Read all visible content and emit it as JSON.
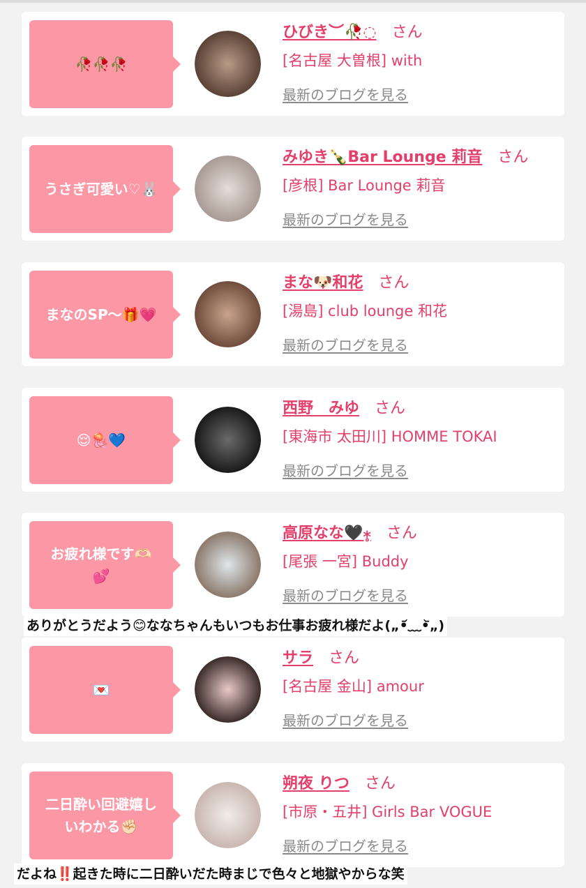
{
  "blog_link_label": "最新のブログを見る",
  "honorific": "さん",
  "colors": {
    "bubble": "#fc97a5",
    "name": "#e43f6a",
    "link_gray": "#8a8a8a",
    "card_bg": "#ffffff",
    "page_bg": "#f2f2f2"
  },
  "entries": [
    {
      "bubble_text": "🥀🥀🥀",
      "name": "ひびき︶🥀◌",
      "shop": "[名古屋 大曽根] with",
      "avatar_colors": [
        "#b89a86",
        "#5a4236"
      ]
    },
    {
      "bubble_text": "うさぎ可愛い♡🐰",
      "name": "みゆき🍾Bar Lounge 莉音",
      "shop": "[彦根] Bar Lounge 莉音",
      "avatar_colors": [
        "#e6dcd8",
        "#a89a94"
      ]
    },
    {
      "bubble_text": "まなのSP〜🎁💗",
      "name": "まな🐶和花",
      "shop": "[湯島] club lounge 和花",
      "avatar_colors": [
        "#c9a38c",
        "#6f4c3c"
      ]
    },
    {
      "bubble_text": "😌🪼💙",
      "name": "西野　みゆ",
      "shop": "[東海市 太田川] HOMME TOKAI",
      "avatar_colors": [
        "#6a6a6a",
        "#1a1a1a"
      ]
    },
    {
      "bubble_text": "お疲れ様です🫶🏻\n💕",
      "name": "高原なな🖤⁎̥",
      "shop": "[尾張 一宮] Buddy",
      "avatar_colors": [
        "#dfe6ea",
        "#8c7a6c"
      ]
    },
    {
      "bubble_text": "💌",
      "name": "サラ",
      "shop": "[名古屋 金山] amour",
      "avatar_colors": [
        "#e9c9c6",
        "#3a2c2a"
      ]
    },
    {
      "bubble_text": "二日酔い回避嬉し\nいわかる✊🏻",
      "name": "朔夜 りつ",
      "shop": "[市原・五井] Girls Bar VOGUE",
      "avatar_colors": [
        "#f1ecea",
        "#c9b7b0"
      ]
    }
  ],
  "captions": [
    "ありがとうだよう😊ななちゃんもいつもお仕事お疲れ様だよ(„•᷄﹏•᷅„)",
    "だよね‼️起きた時に二日酔いだた時まじで色々と地獄やからな笑"
  ]
}
